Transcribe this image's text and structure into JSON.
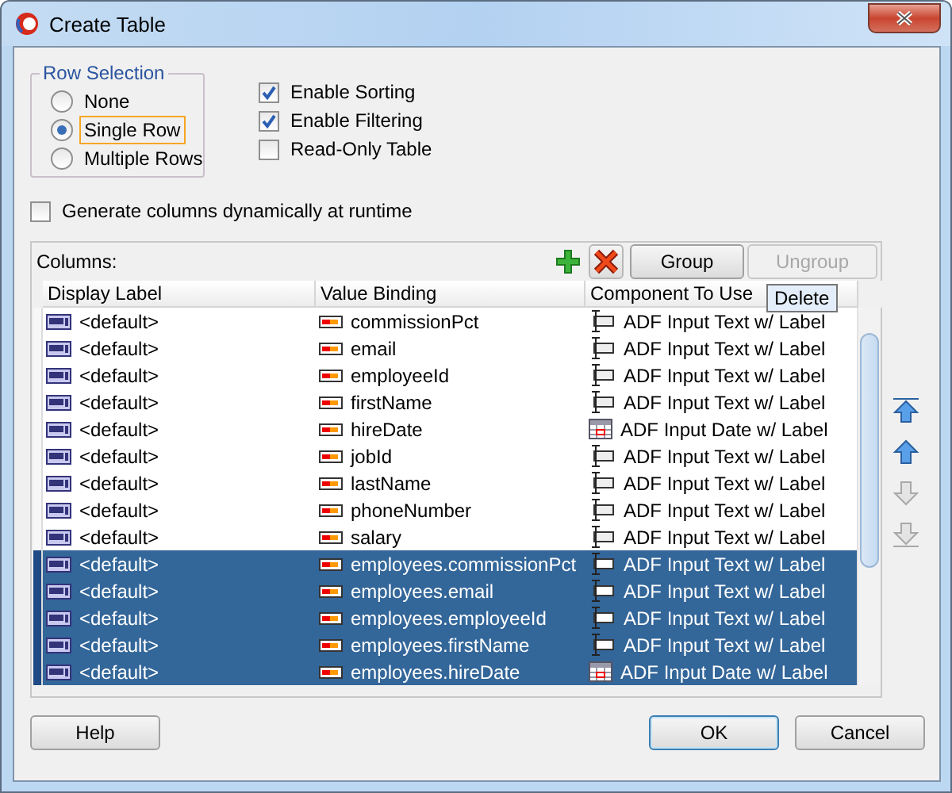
{
  "window": {
    "title": "Create Table"
  },
  "row_selection": {
    "title": "Row Selection",
    "options": [
      {
        "label": "None",
        "selected": false
      },
      {
        "label": "Single Row",
        "selected": true
      },
      {
        "label": "Multiple Rows",
        "selected": false
      }
    ]
  },
  "options": [
    {
      "label": "Enable Sorting",
      "checked": true
    },
    {
      "label": "Enable Filtering",
      "checked": true
    },
    {
      "label": "Read-Only Table",
      "checked": false
    }
  ],
  "generate_columns": {
    "label": "Generate columns dynamically at runtime",
    "checked": false
  },
  "columns": {
    "label": "Columns:",
    "toolbar": [
      {
        "kind": "add"
      },
      {
        "kind": "delete"
      },
      {
        "kind": "text",
        "label": "Group",
        "disabled": false
      },
      {
        "kind": "text",
        "label": "Ungroup",
        "disabled": true
      }
    ],
    "tooltip": "Delete",
    "headers": [
      "Display Label",
      "Value Binding",
      "Component To Use"
    ],
    "rows": [
      {
        "label": "<default>",
        "binding": "commissionPct",
        "component": "ADF Input Text w/ Label",
        "kind": "text",
        "selected": false
      },
      {
        "label": "<default>",
        "binding": "email",
        "component": "ADF Input Text w/ Label",
        "kind": "text",
        "selected": false
      },
      {
        "label": "<default>",
        "binding": "employeeId",
        "component": "ADF Input Text w/ Label",
        "kind": "text",
        "selected": false
      },
      {
        "label": "<default>",
        "binding": "firstName",
        "component": "ADF Input Text w/ Label",
        "kind": "text",
        "selected": false
      },
      {
        "label": "<default>",
        "binding": "hireDate",
        "component": "ADF Input Date w/ Label",
        "kind": "date",
        "selected": false
      },
      {
        "label": "<default>",
        "binding": "jobId",
        "component": "ADF Input Text w/ Label",
        "kind": "text",
        "selected": false
      },
      {
        "label": "<default>",
        "binding": "lastName",
        "component": "ADF Input Text w/ Label",
        "kind": "text",
        "selected": false
      },
      {
        "label": "<default>",
        "binding": "phoneNumber",
        "component": "ADF Input Text w/ Label",
        "kind": "text",
        "selected": false
      },
      {
        "label": "<default>",
        "binding": "salary",
        "component": "ADF Input Text w/ Label",
        "kind": "text",
        "selected": false
      },
      {
        "label": "<default>",
        "binding": "employees.commissionPct",
        "component": "ADF Input Text w/ Label",
        "kind": "text",
        "selected": true
      },
      {
        "label": "<default>",
        "binding": "employees.email",
        "component": "ADF Input Text w/ Label",
        "kind": "text",
        "selected": true
      },
      {
        "label": "<default>",
        "binding": "employees.employeeId",
        "component": "ADF Input Text w/ Label",
        "kind": "text",
        "selected": true
      },
      {
        "label": "<default>",
        "binding": "employees.firstName",
        "component": "ADF Input Text w/ Label",
        "kind": "text",
        "selected": true
      },
      {
        "label": "<default>",
        "binding": "employees.hireDate",
        "component": "ADF Input Date w/ Label",
        "kind": "date",
        "selected": true
      }
    ]
  },
  "move_buttons": [
    {
      "kind": "top",
      "disabled": false
    },
    {
      "kind": "up",
      "disabled": false
    },
    {
      "kind": "down",
      "disabled": true
    },
    {
      "kind": "bottom",
      "disabled": true
    }
  ],
  "buttons": [
    {
      "label": "Help",
      "kind": "help"
    },
    {
      "label": "OK",
      "kind": "ok"
    },
    {
      "label": "Cancel",
      "kind": "cancel"
    }
  ]
}
